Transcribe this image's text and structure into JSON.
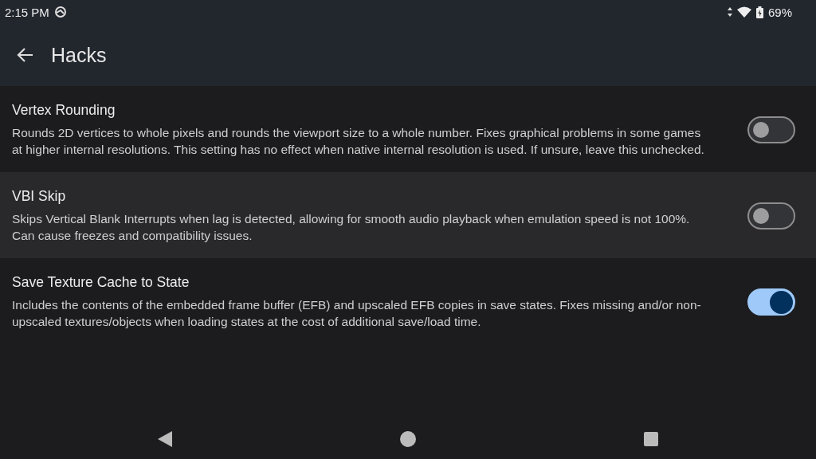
{
  "status_bar": {
    "time": "2:15 PM",
    "battery": "69%"
  },
  "app_bar": {
    "title": "Hacks"
  },
  "settings": [
    {
      "title": "Vertex Rounding",
      "description": "Rounds 2D vertices to whole pixels and rounds the viewport size to a whole number. Fixes graphical problems in some games at higher internal resolutions. This setting has no effect when native internal resolution is used. If unsure, leave this unchecked.",
      "on": false,
      "highlighted": false
    },
    {
      "title": "VBI Skip",
      "description": "Skips Vertical Blank Interrupts when lag is detected, allowing for smooth audio playback when emulation speed is not 100%. Can cause freezes and compatibility issues.",
      "on": false,
      "highlighted": true
    },
    {
      "title": "Save Texture Cache to State",
      "description": "Includes the contents of the embedded frame buffer (EFB) and upscaled EFB copies in save states. Fixes missing and/or non-upscaled textures/objects when loading states at the cost of additional save/load time.",
      "on": true,
      "highlighted": false
    }
  ]
}
